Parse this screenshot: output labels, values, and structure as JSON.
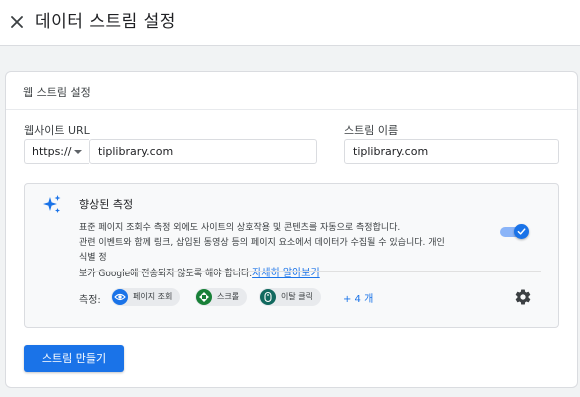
{
  "header": {
    "close_icon": "close-icon",
    "title": "데이터 스트림 설정"
  },
  "card": {
    "title": "웹 스트림 설정",
    "website_url": {
      "label": "웹사이트 URL",
      "protocol": "https://",
      "value": "tiplibrary.com"
    },
    "stream_name": {
      "label": "스트림 이름",
      "value": "tiplibrary.com"
    },
    "enhanced_measurement": {
      "icon": "sparkle-icon",
      "title": "향상된 측정",
      "description_line1": "표준 페이지 조회수 측정 외에도 사이트의 상호작용 및 콘텐츠를 자동으로 측정합니다.",
      "description_line2": "관련 이벤트와 함께 링크, 삽입된 동영상 등의 페이지 요소에서 데이터가 수집될 수 있습니다. 개인 식별 정",
      "description_line3": "보가 Google에 전송되지 않도록 해야 합니다.",
      "learn_more": "자세히 알아보기",
      "enabled": true,
      "events_label": "측정:",
      "events": [
        {
          "label": "페이지 조회",
          "icon": "eye-icon",
          "color": "#1a73e8"
        },
        {
          "label": "스크롤",
          "icon": "scroll-arrows-icon",
          "color": "#188038"
        },
        {
          "label": "이탈 클릭",
          "icon": "mouse-icon",
          "color": "#12695f"
        }
      ],
      "more_events": "+ 4 개",
      "settings_icon": "gear-icon"
    },
    "create_button": "스트림 만들기"
  },
  "colors": {
    "accent": "#1a73e8",
    "background": "#f1f3f4"
  }
}
